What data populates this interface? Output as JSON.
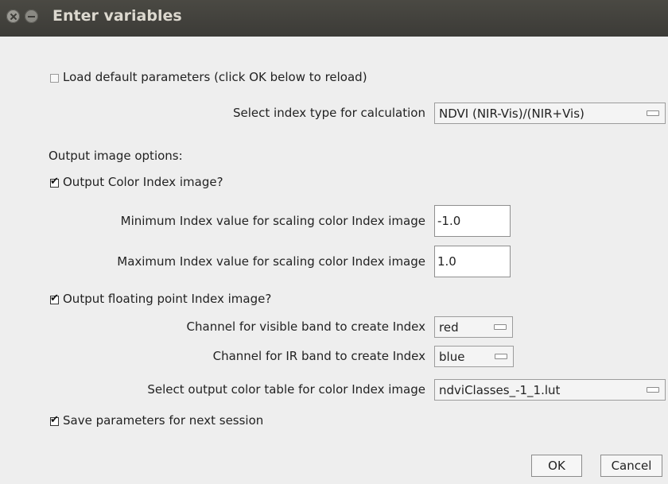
{
  "window": {
    "title": "Enter variables"
  },
  "load_defaults": {
    "label": "Load default parameters (click OK below to reload)",
    "checked": false
  },
  "index_type": {
    "label": "Select index type for calculation",
    "value": "NDVI (NIR-Vis)/(NIR+Vis)"
  },
  "output_options_heading": "Output image options:",
  "output_color": {
    "label": "Output Color Index image?",
    "checked": true
  },
  "min_index": {
    "label": "Minimum Index value for scaling color Index image",
    "value": "-1.0"
  },
  "max_index": {
    "label": "Maximum Index value for scaling color Index image",
    "value": "1.0"
  },
  "output_float": {
    "label": "Output floating point Index image?",
    "checked": true
  },
  "visible_channel": {
    "label": "Channel for visible band to create Index",
    "value": "red"
  },
  "ir_channel": {
    "label": "Channel for IR band to create Index",
    "value": "blue"
  },
  "color_table": {
    "label": "Select output color table for color Index image",
    "value": "ndviClasses_-1_1.lut"
  },
  "save_params": {
    "label": "Save parameters for next session",
    "checked": true
  },
  "buttons": {
    "ok": "OK",
    "cancel": "Cancel"
  }
}
